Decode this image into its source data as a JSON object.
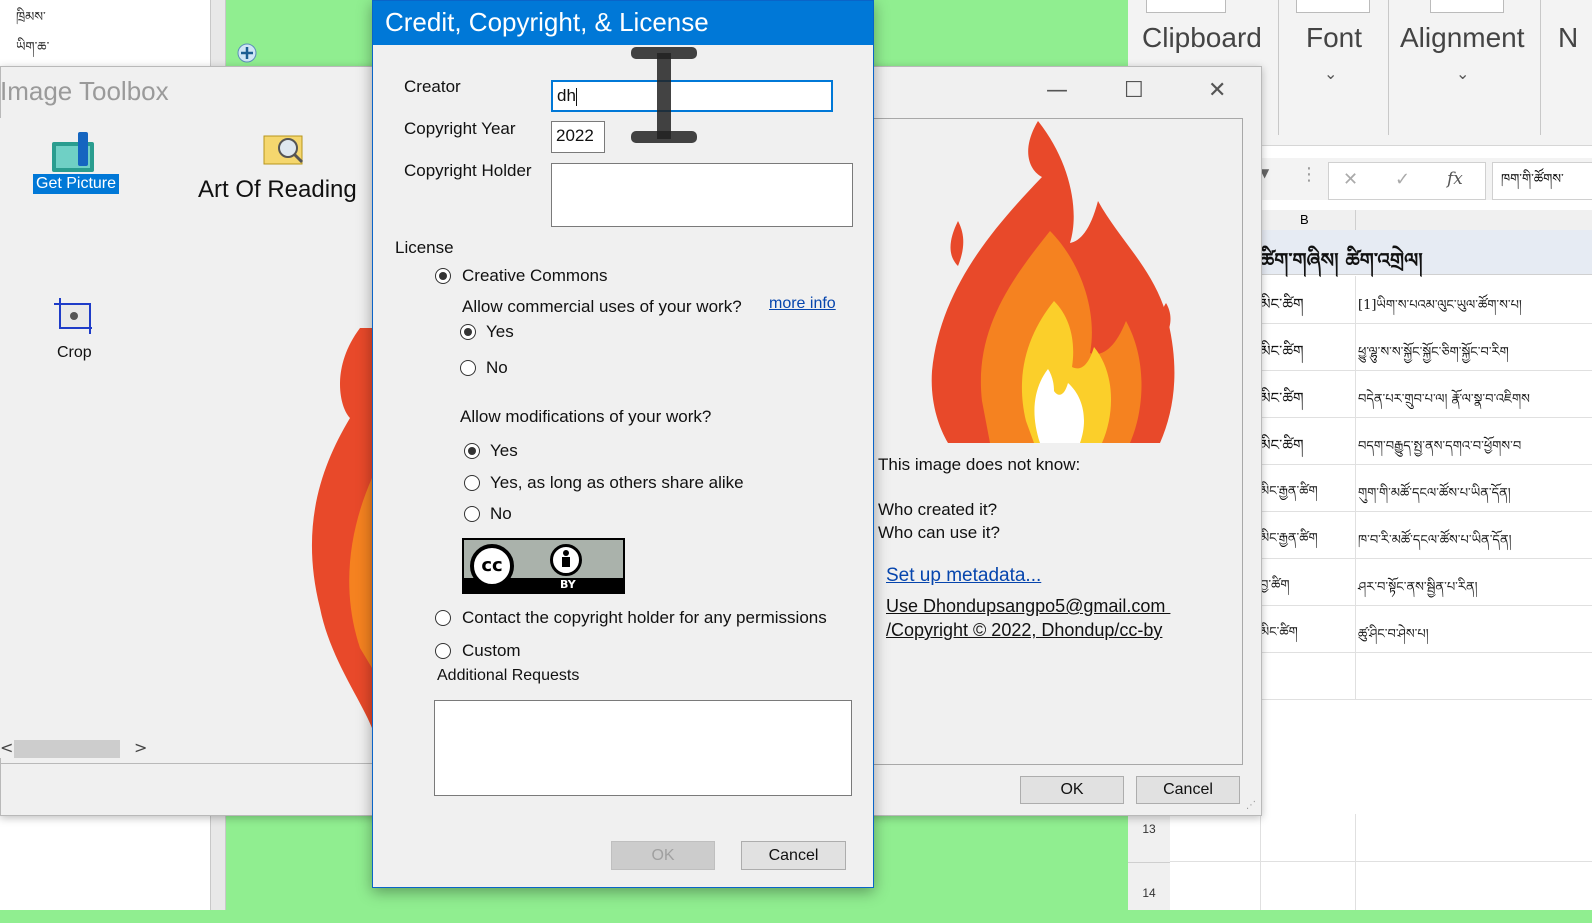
{
  "colors": {
    "desktop_green": "#90ee90",
    "dialog_title_bg": "#0078d7",
    "link_blue": "#0645ad",
    "selection_blue": "#0078d7"
  },
  "background_app": {
    "tib_line_1": "ཁྲིམས་",
    "tib_line_2": "ཡིག་ཆ་"
  },
  "excel": {
    "ribbon": {
      "clipboard": "Clipboard",
      "font": "Font",
      "alignment": "Alignment",
      "next": "N"
    },
    "formula_bar": {
      "cancel": "✕",
      "enter": "✓",
      "fx": "fx",
      "content": "ཁག་གི་ཚོགས་"
    },
    "column_header": "B",
    "header_row": "ཚིག་གཞིས། ཚིག་འགྲེལ།",
    "rows": [
      {
        "a": "མིང་ཚིག",
        "b": "[1]ཡིག་ས་པའམ་ལུང་ཡུལ་ཚོག་ས་པ།"
      },
      {
        "a": "མིང་ཚིག",
        "b": "ཕྱུ་ལྷུ་ས་ས་སྐྱོང་སྐྱོང་ཅིག་སྐྱོང་བ་རིག"
      },
      {
        "a": "མིང་ཚིག",
        "b": "བདེན་པར་གྲུབ་པ་ལ། རྣོ་ལ་སྣ་བ་འཇིགས"
      },
      {
        "a": "མིང་ཚིག",
        "b": "བདག་བརྒྱུད་སྤྱ་ནས་དགའ་བ་ཕྱོགས་བ"
      },
      {
        "a": "མིང་རྒྱན་ཚིག",
        "b": "གུག་གི་མཚོ་དངལ་ཚོས་པ་ཡིན་དོན།"
      },
      {
        "a": "མིང་རྒྱན་ཚིག",
        "b": "ཁ་བ་རི་མཚོ་དངལ་ཚོས་པ་ཡིན་དོན།"
      },
      {
        "a": "བྱ་ཚིག",
        "b": "ཤར་བ་སྟོང་ནས་སྦྱིན་པ་རིན།"
      },
      {
        "a": "མིང་ཚིག",
        "b": "ཚུ་ཤིང་བ་ཤེས་པ།"
      }
    ],
    "row_numbers": [
      "13",
      "14"
    ]
  },
  "toolbox": {
    "title": "Image Toolbox",
    "get_picture": "Get Picture",
    "art_of_reading": "Art Of Reading",
    "crop": "Crop",
    "minimize": "—",
    "maximize": "☐",
    "close": "✕",
    "scroll_left": "<",
    "scroll_right": ">",
    "metadata": {
      "line1": "This image does not know:",
      "line2": "Who created it?",
      "line3": "Who can use it?",
      "setup_link": "Set up metadata...",
      "use_line1": "Use Dhondupsangpo5@gmail.com ",
      "use_line2": "/Copyright © 2022, Dhondup/cc-by"
    },
    "ok": "OK",
    "cancel": "Cancel"
  },
  "dialog": {
    "title": "Credit, Copyright, & License",
    "creator_label": "Creator",
    "creator_value": "dh",
    "year_label": "Copyright Year",
    "year_value": "2022",
    "holder_label": "Copyright Holder",
    "holder_value": "",
    "license_label": "License",
    "creative_commons": "Creative Commons",
    "commercial_q": "Allow commercial uses of your work?",
    "more_info": "more info",
    "yes": "Yes",
    "no": "No",
    "modifications_q": "Allow modifications of your work?",
    "share_alike": "Yes, as long as others share alike",
    "cc_by": "BY",
    "contact_holder": "Contact the copyright holder for any permissions",
    "custom": "Custom",
    "additional_requests": "Additional Requests",
    "ok": "OK",
    "cancel": "Cancel",
    "selected_license": "Creative Commons",
    "commercial_selected": "Yes",
    "modifications_selected": "Yes"
  }
}
